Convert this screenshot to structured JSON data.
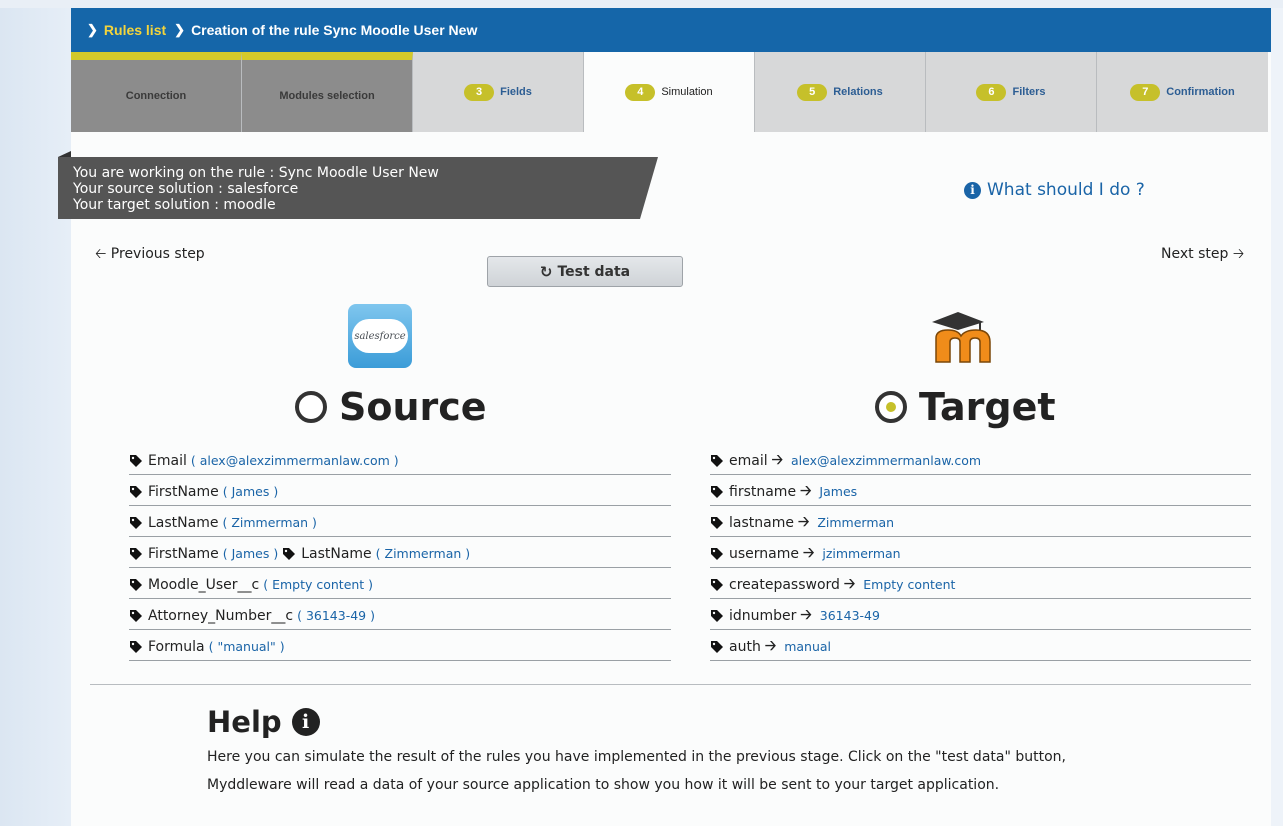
{
  "breadcrumb": {
    "rules_list": "Rules list",
    "current": "Creation of the rule Sync Moodle User New"
  },
  "tabs": [
    {
      "label": "Connection",
      "num": "",
      "state": "done"
    },
    {
      "label": "Modules selection",
      "num": "",
      "state": "done"
    },
    {
      "label": "Fields",
      "num": "3",
      "state": "todo"
    },
    {
      "label": "Simulation",
      "num": "4",
      "state": "active"
    },
    {
      "label": "Relations",
      "num": "5",
      "state": "todo"
    },
    {
      "label": "Filters",
      "num": "6",
      "state": "todo"
    },
    {
      "label": "Confirmation",
      "num": "7",
      "state": "todo"
    }
  ],
  "info_ribbon": {
    "rule": "You are working on the rule : Sync Moodle User New",
    "source": "Your source solution : salesforce",
    "target": "Your target solution : moodle"
  },
  "help_link": "What should I do ?",
  "nav": {
    "previous": "Previous step",
    "next": "Next step"
  },
  "test_button": "Test data",
  "logos": {
    "source": "salesforce"
  },
  "source": {
    "title": "Source",
    "fields": [
      {
        "name": "Email",
        "value": "( alex@alexzimmermanlaw.com )"
      },
      {
        "name": "FirstName",
        "value": "( James )"
      },
      {
        "name": "LastName",
        "value": "( Zimmerman )"
      },
      {
        "name": "FirstName",
        "value": "( James )",
        "name2": "LastName",
        "value2": "( Zimmerman )"
      },
      {
        "name": "Moodle_User__c",
        "value": "( Empty content )"
      },
      {
        "name": "Attorney_Number__c",
        "value": "( 36143-49 )"
      },
      {
        "name": "Formula",
        "value": "( \"manual\" )"
      }
    ]
  },
  "target": {
    "title": "Target",
    "fields": [
      {
        "name": "email",
        "value": "alex@alexzimmermanlaw.com"
      },
      {
        "name": "firstname",
        "value": "James"
      },
      {
        "name": "lastname",
        "value": "Zimmerman"
      },
      {
        "name": "username",
        "value": "jzimmerman"
      },
      {
        "name": "createpassword",
        "value": "Empty content"
      },
      {
        "name": "idnumber",
        "value": "36143-49"
      },
      {
        "name": "auth",
        "value": "manual"
      }
    ]
  },
  "help": {
    "title": "Help",
    "text": "Here you can simulate the result of the rules you have implemented in the previous stage. Click on the \"test data\" button, Myddleware will read a data of your source application to show you how it will be sent to your target application."
  },
  "colors": {
    "header": "#1566a9",
    "accent": "#c6c02a",
    "link": "#1a64a7"
  },
  "icons": {
    "tag": "tag-icon",
    "arrow": "arrow-right-icon",
    "refresh": "refresh-icon",
    "info": "info-icon"
  }
}
